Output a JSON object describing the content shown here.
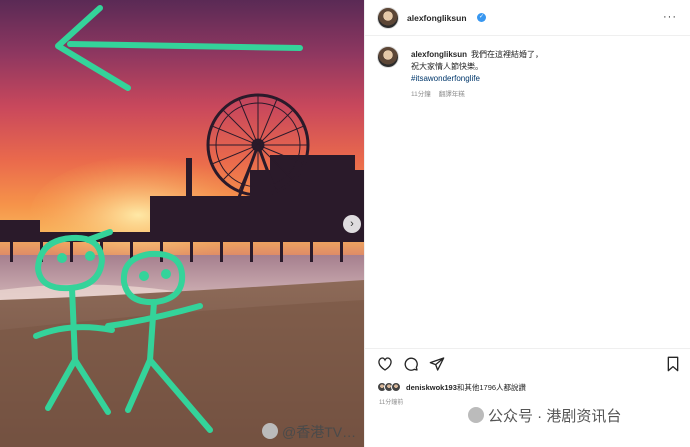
{
  "post": {
    "username": "alexfongliksun",
    "caption_line1": "我們在這裡結婚了，",
    "caption_line2": "祝大家情人節快樂。",
    "hashtag": "#itsawonderfonglife",
    "time": "11分鐘",
    "translate": "翻譯年糕",
    "more_icon": "more-horizontal-icon",
    "verified_icon": "verified-badge-icon"
  },
  "image": {
    "description_icon": "santa-monica-pier-photo",
    "doodle_icon": "green-doodle-arrow-and-stick-figures",
    "next_icon": "chevron-right-icon"
  },
  "actions": {
    "like_icon": "heart-icon",
    "comment_icon": "comment-icon",
    "share_icon": "send-icon",
    "save_icon": "bookmark-icon"
  },
  "likes": {
    "liker": "deniskwok193",
    "rest": "和其他1796人都說讚",
    "time": "11分鐘前"
  },
  "watermarks": {
    "weibo": "@香港TV",
    "weibo_tail": "…",
    "wechat": "公众号 · 港剧资讯台"
  },
  "colors": {
    "link": "#00376b",
    "verified": "#3897f0",
    "doodle": "#34d39a"
  }
}
